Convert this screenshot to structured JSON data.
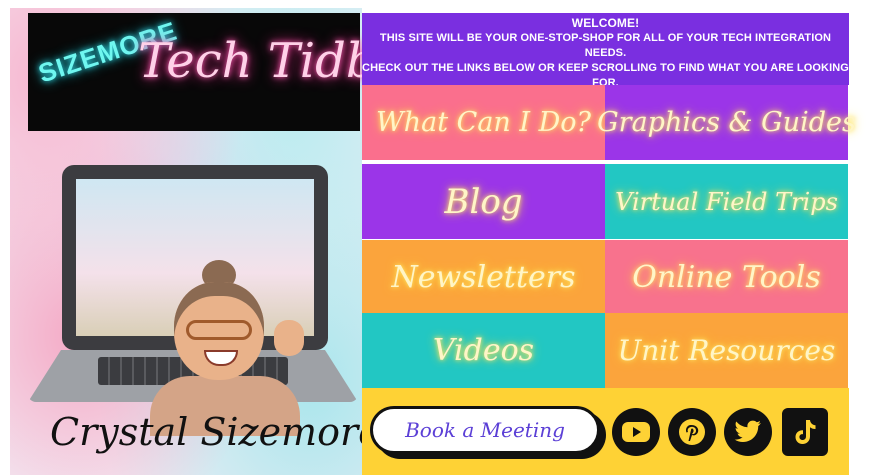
{
  "header": {
    "logo_small": "SIZEMORE",
    "logo_script": "Tech Tidbits"
  },
  "welcome": {
    "title": "WELCOME!",
    "line1": "THIS SITE WILL BE YOUR ONE-STOP-SHOP FOR ALL OF YOUR TECH INTEGRATION NEEDS.",
    "line2": "CHECK OUT THE LINKS BELOW OR KEEP SCROLLING TO FIND WHAT YOU ARE LOOKING FOR."
  },
  "signature": "Crystal Sizemore",
  "tiles": {
    "what_can_i_do": "What Can I Do?",
    "graphics_guides": "Graphics & Guides",
    "blog": "Blog",
    "virtual_field_trips": "Virtual Field Trips",
    "newsletters": "Newsletters",
    "online_tools": "Online Tools",
    "videos": "Videos",
    "unit_resources": "Unit Resources"
  },
  "bottom": {
    "book_meeting": "Book a Meeting",
    "socials": [
      "youtube",
      "pinterest",
      "twitter",
      "tiktok"
    ]
  },
  "colors": {
    "purple": "#9b35e8",
    "pink": "#fa6f8d",
    "teal": "#22c7c3",
    "orange": "#fba43c",
    "yellow": "#fed235"
  }
}
